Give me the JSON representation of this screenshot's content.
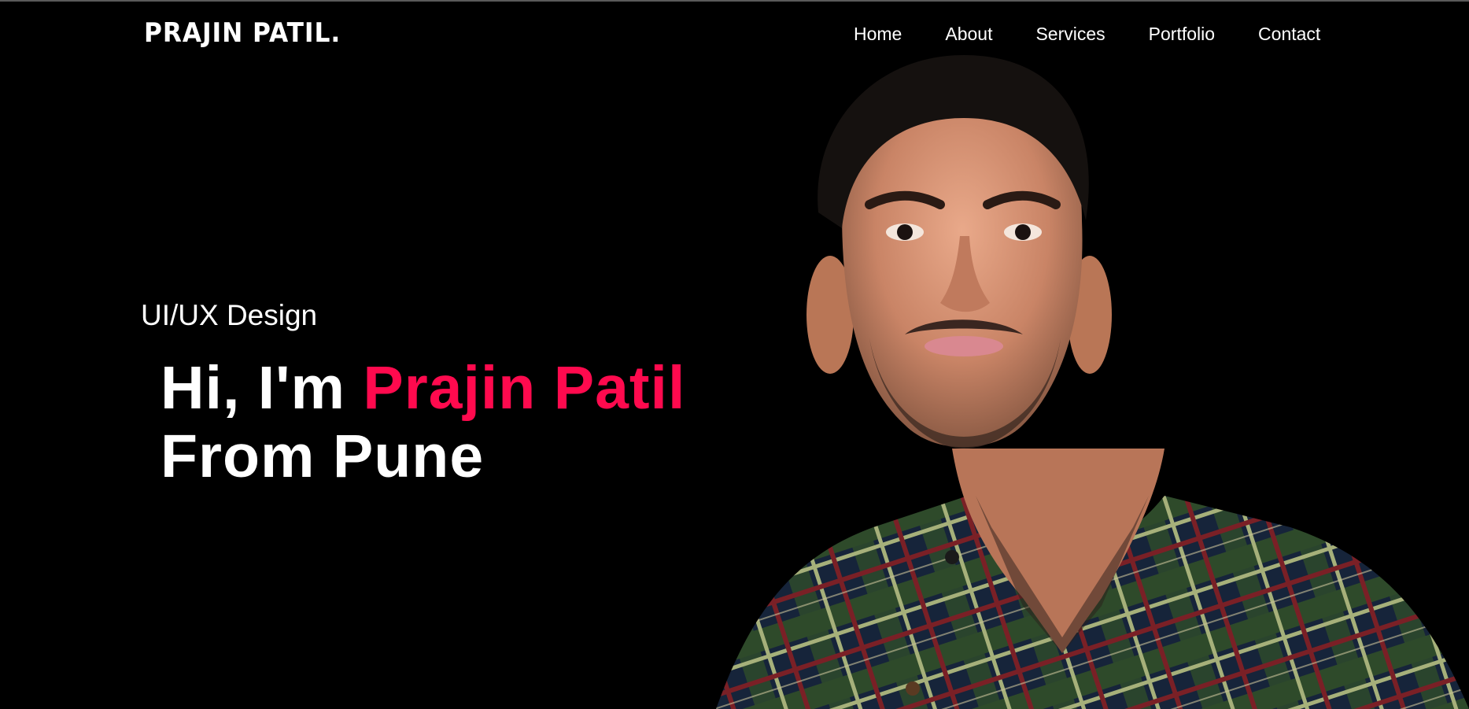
{
  "brand": {
    "logo_text": "PRAJIN PATIL."
  },
  "nav": {
    "items": [
      {
        "label": "Home"
      },
      {
        "label": "About"
      },
      {
        "label": "Services"
      },
      {
        "label": "Portfolio"
      },
      {
        "label": "Contact"
      }
    ]
  },
  "hero": {
    "subtitle": "UI/UX Design",
    "greeting": "Hi, I'm ",
    "name": "Prajin Patil",
    "location_line": "From Pune"
  },
  "colors": {
    "background": "#000000",
    "text": "#ffffff",
    "accent": "#ff0a4e"
  }
}
